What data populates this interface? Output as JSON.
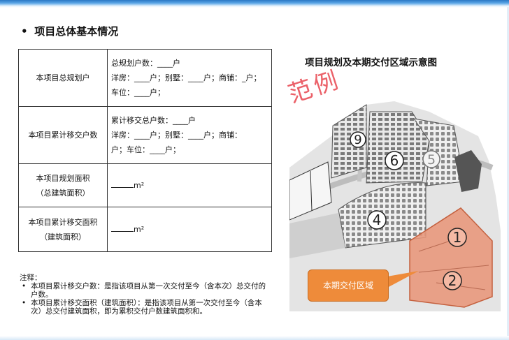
{
  "heading": "项目总体基本情况",
  "bullet": "•",
  "table": {
    "row1": {
      "label": "本项目总规划户",
      "line1": "总规划户数：____户",
      "line2": "洋房：____户；别墅：____户；商铺：_户；",
      "line3": "车位：____户；"
    },
    "row2": {
      "label": "本项目累计移交户数",
      "line1": "累计移交总户数：____户",
      "line2": "洋房：____户；别墅：____户；商铺：",
      "line3": "户；车位：____户；"
    },
    "row3": {
      "label1": "本项目规划面积",
      "label2": "（总建筑面积）",
      "value": "m²"
    },
    "row4": {
      "label1": "本项目累计移交面积",
      "label2": "（建筑面积）",
      "value": "m²"
    }
  },
  "notes": {
    "title": "注释：",
    "items": [
      "本项目累计移交户数：是指该项目从第一次交付至今（含本次）总交付的户数。",
      "本项目累计移交面积（建筑面积）：是指该项目从第一次交付至今（含本次）总交付建筑面积，即为累积交付户数建筑面积和。"
    ]
  },
  "map": {
    "title": "项目规划及本期交付区域示意图",
    "watermark": "范例",
    "zones": [
      "9",
      "6",
      "5",
      "4",
      "1",
      "2"
    ],
    "callout": "本期交付区域",
    "highlight_color": "#e8967a"
  }
}
